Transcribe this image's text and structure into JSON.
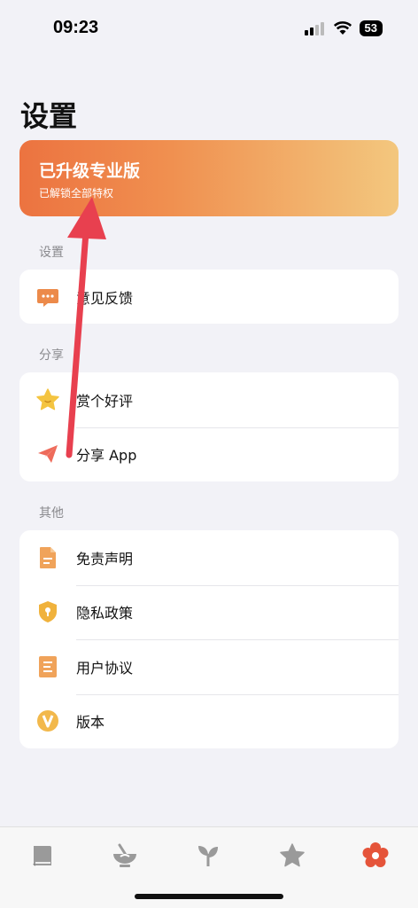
{
  "status_bar": {
    "time": "09:23",
    "battery": "53"
  },
  "page_title": "设置",
  "pro_card": {
    "title": "已升级专业版",
    "subtitle": "已解锁全部特权"
  },
  "sections": {
    "settings": {
      "header": "设置",
      "items": [
        {
          "label": "意见反馈",
          "icon": "feedback-chat-icon"
        }
      ]
    },
    "share": {
      "header": "分享",
      "items": [
        {
          "label": "赏个好评",
          "icon": "star-icon"
        },
        {
          "label": "分享 App",
          "icon": "paper-plane-icon"
        }
      ]
    },
    "other": {
      "header": "其他",
      "items": [
        {
          "label": "免责声明",
          "icon": "document-icon"
        },
        {
          "label": "隐私政策",
          "icon": "shield-lock-icon"
        },
        {
          "label": "用户协议",
          "icon": "list-document-icon"
        },
        {
          "label": "版本",
          "icon": "version-v-icon"
        }
      ]
    }
  },
  "tab_bar": {
    "tabs": [
      "book-icon",
      "mortar-bowl-icon",
      "sprout-icon",
      "star-tab-icon",
      "flower-gear-icon"
    ],
    "active_index": 4
  },
  "colors": {
    "accent": "#e5543a",
    "icon_orange": "#f0a35a",
    "background": "#f2f2f7",
    "arrow": "#e8404f"
  }
}
